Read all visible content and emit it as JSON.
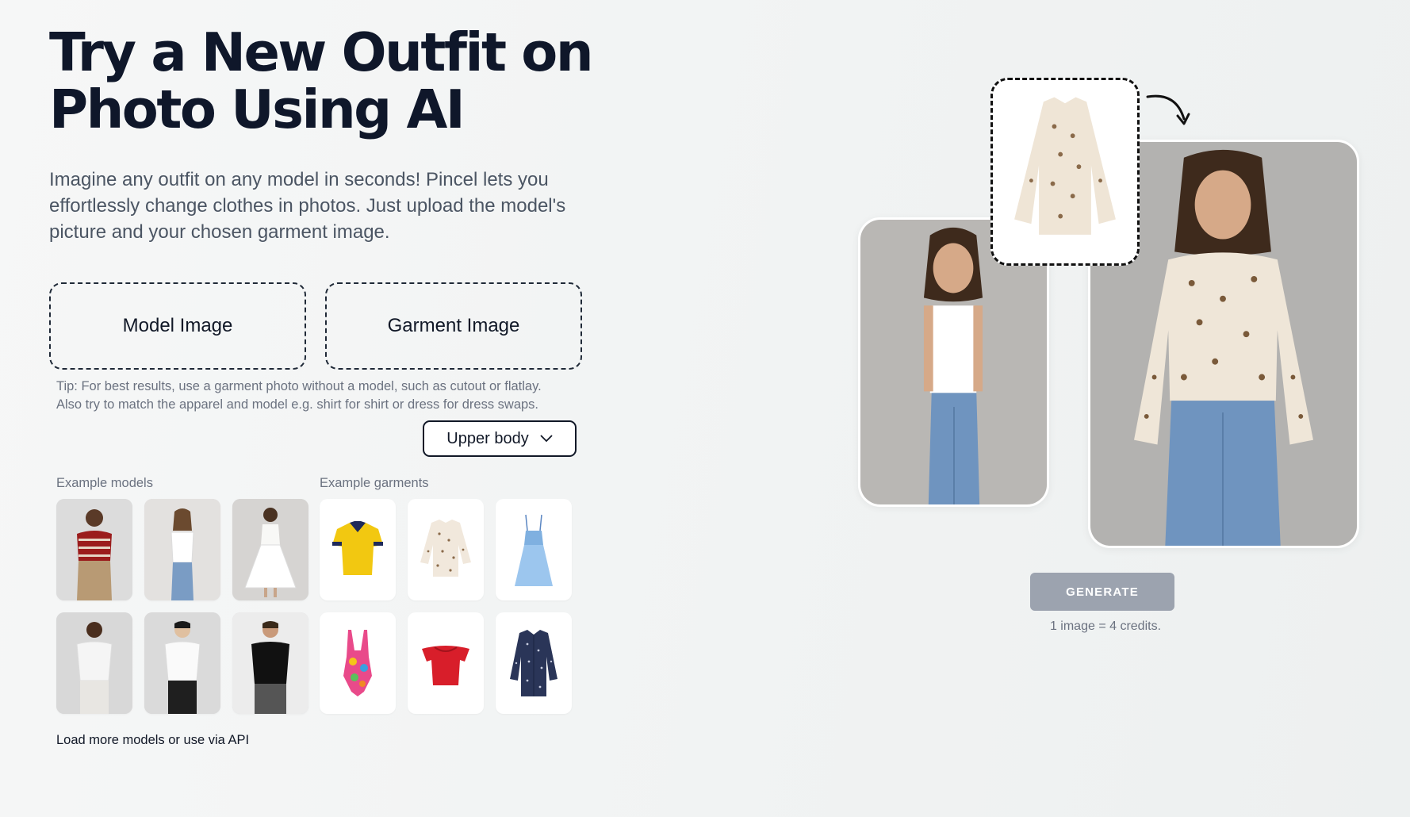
{
  "hero": {
    "title_line1": "Try a New Outfit on",
    "title_line2": "Photo Using AI",
    "subtitle": "Imagine any outfit on any model in seconds! Pincel lets you effortlessly change clothes in photos. Just upload the model's picture and your chosen garment image."
  },
  "upload": {
    "model_label": "Model Image",
    "garment_label": "Garment Image"
  },
  "tip": {
    "line1": "Tip: For best results, use a garment photo without a model, such as cutout or flatlay.",
    "line2": "Also try to match the apparel and model e.g. shirt for shirt or dress for dress swaps."
  },
  "body_select": {
    "value": "Upper body"
  },
  "examples": {
    "models_label": "Example models",
    "garments_label": "Example garments"
  },
  "load_more": {
    "link": "Load more models",
    "separator": " or ",
    "api_link": "use via API"
  },
  "generate": {
    "button_label": "GENERATE",
    "credits_text": "1 image = 4 credits."
  },
  "colors": {
    "button_disabled": "#9ca3af",
    "title": "#0f172a",
    "body_text": "#4b5563"
  }
}
